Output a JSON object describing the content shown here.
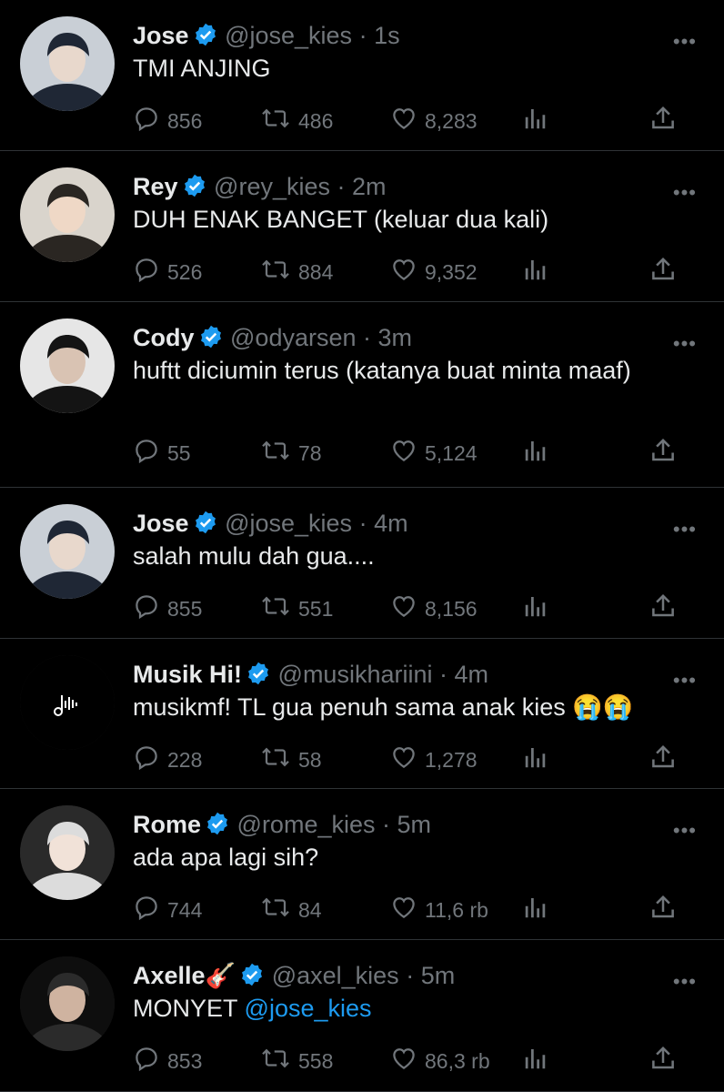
{
  "colors": {
    "background": "#000000",
    "text": "#e7e9ea",
    "secondary": "#71767b",
    "verified": "#1d9bf0",
    "mention": "#1d9bf0",
    "divider": "#2f3336"
  },
  "icons": {
    "reply": "reply-icon",
    "retweet": "retweet-icon",
    "like": "heart-icon",
    "views": "views-icon",
    "share": "share-icon",
    "more": "more-options-icon",
    "verified": "verified-badge-icon"
  },
  "tweets": [
    {
      "name": "Jose",
      "handle": "@jose_kies",
      "sep": "·",
      "time": "1s",
      "text": "TMI ANJING",
      "replies": "856",
      "retweets": "486",
      "likes": "8,283",
      "avatar": "dark-hood"
    },
    {
      "name": "Rey",
      "handle": "@rey_kies",
      "sep": "·",
      "time": "2m",
      "text": "DUH ENAK BANGET (keluar dua kali)",
      "replies": "526",
      "retweets": "884",
      "likes": "9,352",
      "avatar": "light"
    },
    {
      "name": "Cody",
      "handle": "@odyarsen",
      "sep": "·",
      "time": "3m",
      "text": "huftt diciumin terus (katanya buat minta maaf)",
      "replies": "55",
      "retweets": "78",
      "likes": "5,124",
      "avatar": "grey"
    },
    {
      "name": "Jose",
      "handle": "@jose_kies",
      "sep": "·",
      "time": "4m",
      "text": "salah mulu dah gua....",
      "replies": "855",
      "retweets": "551",
      "likes": "8,156",
      "avatar": "dark-hood"
    },
    {
      "name": "Musik Hi!",
      "handle": "@musikhariini",
      "sep": "·",
      "time": "4m",
      "text": "musikmf! TL gua penuh sama anak kies",
      "emoji": "😭😭",
      "replies": "228",
      "retweets": "58",
      "likes": "1,278",
      "avatar": "music"
    },
    {
      "name": "Rome",
      "handle": "@rome_kies",
      "sep": "·",
      "time": "5m",
      "text": "ada apa lagi sih?",
      "replies": "744",
      "retweets": "84",
      "likes": "11,6 rb",
      "avatar": "silver"
    },
    {
      "name": "Axelle",
      "name_emoji": "🎸",
      "handle": "@axel_kies",
      "sep": "·",
      "time": "5m",
      "text": "MONYET",
      "mention": "@jose_kies",
      "replies": "853",
      "retweets": "558",
      "likes": "86,3 rb",
      "avatar": "dark-jacket"
    }
  ]
}
